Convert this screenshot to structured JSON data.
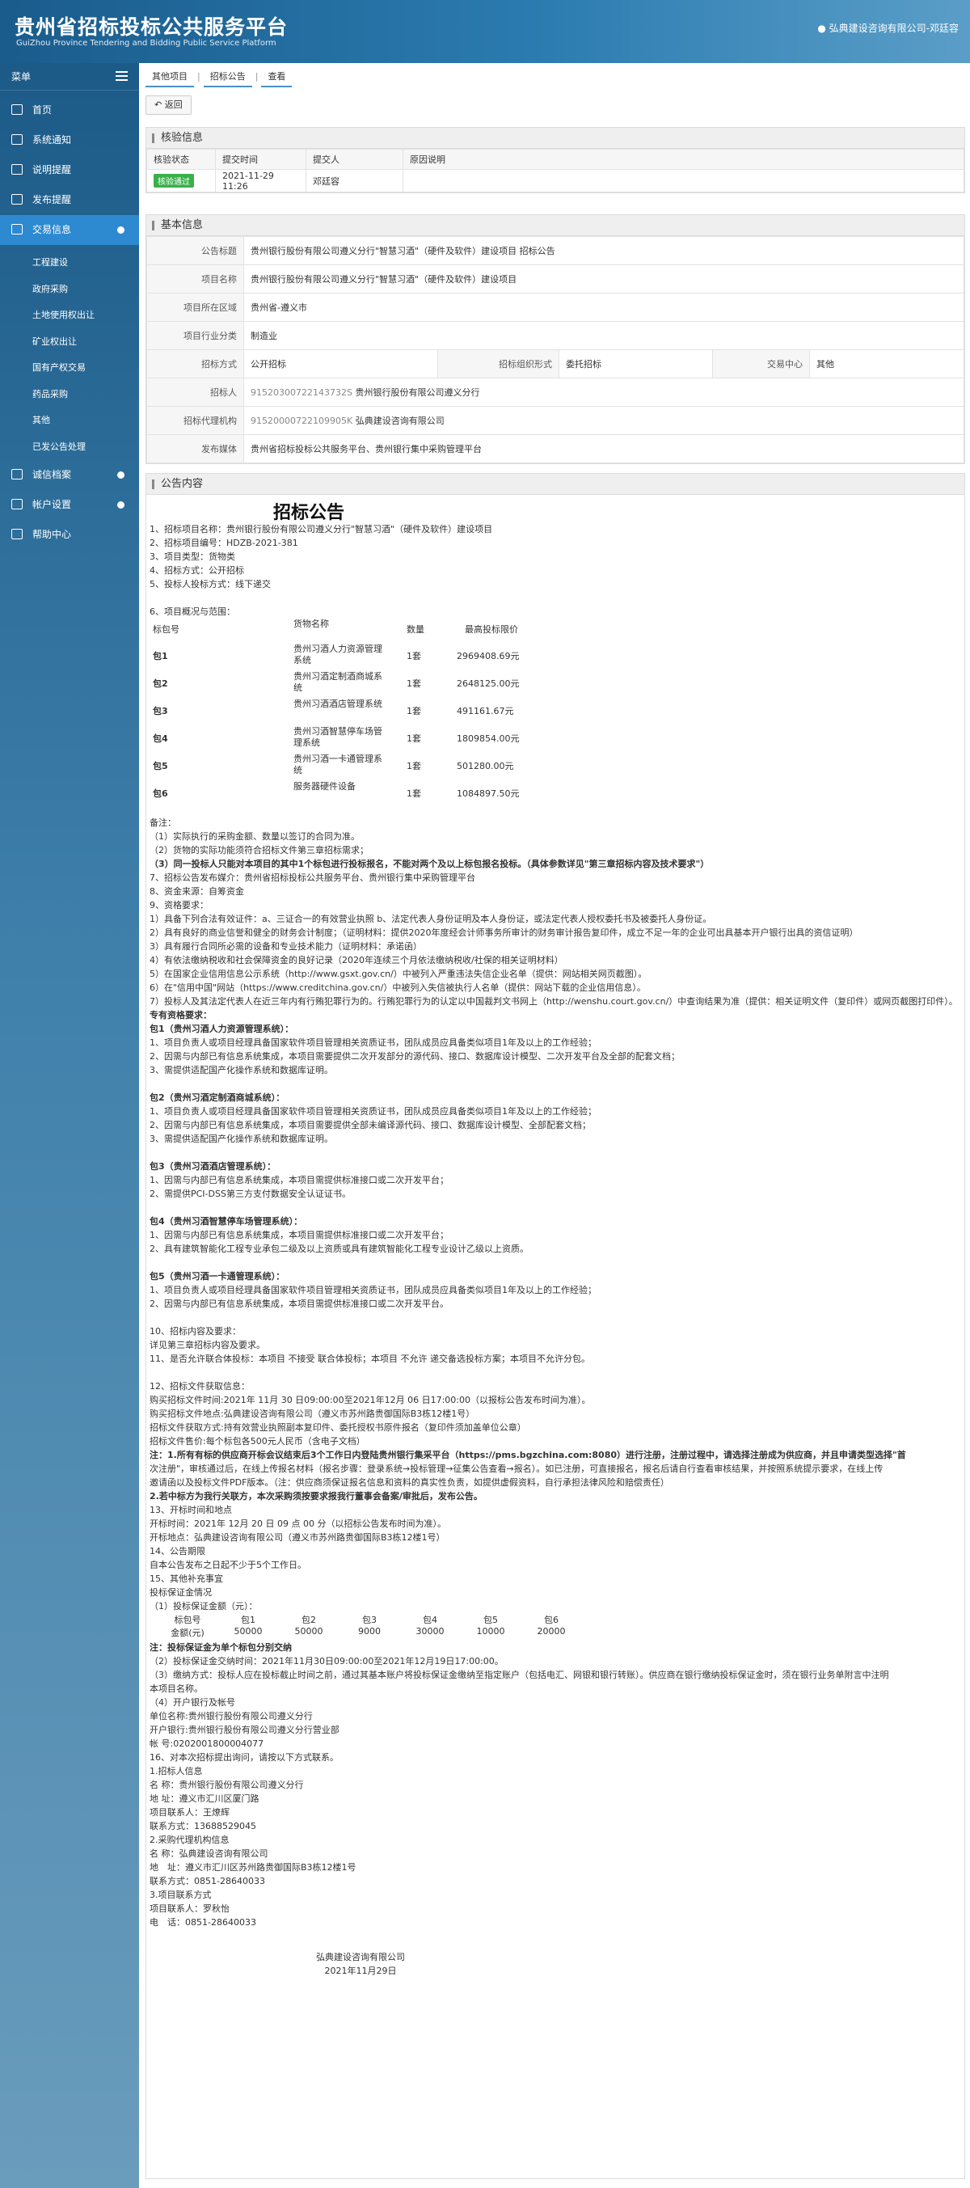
{
  "header": {
    "title_cn": "贵州省招标投标公共服务平台",
    "title_en": "GuiZhou Province Tendering and Bidding Public Service Platform",
    "user": "弘典建设咨询有限公司-邓廷容"
  },
  "sidebar": {
    "menu_label": "菜单",
    "items": [
      {
        "label": "首页",
        "icon": "home-icon"
      },
      {
        "label": "系统通知",
        "icon": "monitor-icon"
      },
      {
        "label": "说明提醒",
        "icon": "book-icon"
      },
      {
        "label": "发布提醒",
        "icon": "doc-icon"
      },
      {
        "label": "交易信息",
        "icon": "list-icon",
        "active": true
      }
    ],
    "sub": [
      "工程建设",
      "政府采购",
      "土地使用权出让",
      "矿业权出让",
      "国有产权交易",
      "药品采购",
      "其他",
      "已发公告处理"
    ],
    "items2": [
      {
        "label": "诚信档案",
        "icon": "archive-icon"
      },
      {
        "label": "帐户设置",
        "icon": "user-icon"
      },
      {
        "label": "帮助中心",
        "icon": "help-icon"
      }
    ]
  },
  "tabs": [
    "其他项目",
    "招标公告",
    "查看"
  ],
  "back": "返回",
  "verify": {
    "title": "核验信息",
    "headers": [
      "核验状态",
      "提交时间",
      "提交人",
      "原因说明"
    ],
    "row": [
      "核验通过",
      "2021-11-29 11:26",
      "邓廷容",
      ""
    ]
  },
  "basic": {
    "title": "基本信息",
    "rows": [
      [
        "公告标题",
        "贵州银行股份有限公司遵义分行\"智慧习酒\"（硬件及软件）建设项目 招标公告"
      ],
      [
        "项目名称",
        "贵州银行股份有限公司遵义分行\"智慧习酒\"（硬件及软件）建设项目"
      ],
      [
        "项目所在区域",
        "贵州省-遵义市"
      ],
      [
        "项目行业分类",
        "制造业"
      ]
    ],
    "method_k": "招标方式",
    "method_v": "公开招标",
    "org_k": "招标组织形式",
    "org_v": "委托招标",
    "center_k": "交易中心",
    "center_v": "其他",
    "bidder_k": "招标人",
    "bidder_code": "91520300722143732S",
    "bidder_v": "贵州银行股份有限公司遵义分行",
    "agent_k": "招标代理机构",
    "agent_code": "91520000722109905K",
    "agent_v": "弘典建设咨询有限公司",
    "media_k": "发布媒体",
    "media_v": "贵州省招标投标公共服务平台、贵州银行集中采购管理平台"
  },
  "notice": {
    "title": "公告内容",
    "doc_title": "招标公告",
    "lines1": [
      "1、招标项目名称：贵州银行股份有限公司遵义分行\"智慧习酒\"（硬件及软件）建设项目",
      "2、招标项目编号：HDZB-2021-381",
      "3、项目类型：货物类",
      "4、招标方式：公开招标",
      "5、投标人投标方式：线下递交",
      "",
      "6、项目概况与范围："
    ],
    "pkg_headers": [
      "标包号",
      "货物名称",
      "数量",
      "最高投标限价"
    ],
    "pkgs": [
      [
        "包1",
        "贵州习酒人力资源管理系统",
        "1套",
        "2969408.69元"
      ],
      [
        "包2",
        "贵州习酒定制酒商城系统",
        "1套",
        "2648125.00元"
      ],
      [
        "包3",
        "贵州习酒酒店管理系统",
        "1套",
        "491161.67元"
      ],
      [
        "包4",
        "贵州习酒智慧停车场管理系统",
        "1套",
        "1809854.00元"
      ],
      [
        "包5",
        "贵州习酒一卡通管理系统",
        "1套",
        "501280.00元"
      ],
      [
        "包6",
        "服务器硬件设备",
        "1套",
        "1084897.50元"
      ]
    ],
    "lines2": [
      "备注：",
      "（1）实际执行的采购金额、数量以签订的合同为准。",
      "（2）货物的实际功能须符合招标文件第三章招标需求；",
      "（3）同一投标人只能对本项目的其中1个标包进行投标报名，不能对两个及以上标包报名投标。（具体参数详见\"第三章招标内容及技术要求\"）",
      "7、招标公告发布媒介：贵州省招标投标公共服务平台、贵州银行集中采购管理平台",
      "8、资金来源：自筹资金",
      "9、资格要求：",
      "1）具备下列合法有效证件：a、三证合一的有效营业执照 b、法定代表人身份证明及本人身份证，或法定代表人授权委托书及被委托人身份证。",
      "2）具有良好的商业信誉和健全的财务会计制度；（证明材料：提供2020年度经会计师事务所审计的财务审计报告复印件，成立不足一年的企业可出具基本开户银行出具的资信证明）",
      "3）具有履行合同所必需的设备和专业技术能力（证明材料：承诺函）",
      "4）有依法缴纳税收和社会保障资金的良好记录（2020年连续三个月依法缴纳税收/社保的相关证明材料）",
      "5）在国家企业信用信息公示系统（http://www.gsxt.gov.cn/）中被列入严重违法失信企业名单（提供：网站相关网页截图）。",
      "6）在\"信用中国\"网站（https://www.creditchina.gov.cn/）中被列入失信被执行人名单（提供：网站下载的企业信用信息）。",
      "7）投标人及其法定代表人在近三年内有行贿犯罪行为的。行贿犯罪行为的认定以中国裁判文书网上（http://wenshu.court.gov.cn/）中查询结果为准（提供：相关证明文件（复印件）或网页截图打印件）。",
      "专有资格要求：",
      "包1（贵州习酒人力资源管理系统）：",
      "1、项目负责人或项目经理具备国家软件项目管理相关资质证书，团队成员应具备类似项目1年及以上的工作经验；",
      "2、因需与内部已有信息系统集成，本项目需要提供二次开发部分的源代码、接口、数据库设计模型、二次开发平台及全部的配套文档；",
      "3、需提供适配国产化操作系统和数据库证明。",
      "",
      "包2（贵州习酒定制酒商城系统）：",
      "1、项目负责人或项目经理具备国家软件项目管理相关资质证书，团队成员应具备类似项目1年及以上的工作经验；",
      "2、因需与内部已有信息系统集成，本项目需要提供全部未编译源代码、接口、数据库设计模型、全部配套文档；",
      "3、需提供适配国产化操作系统和数据库证明。",
      "",
      "包3（贵州习酒酒店管理系统）：",
      "1、因需与内部已有信息系统集成，本项目需提供标准接口或二次开发平台；",
      "2、需提供PCI-DSS第三方支付数据安全认证证书。",
      "",
      "包4（贵州习酒智慧停车场管理系统）：",
      "1、因需与内部已有信息系统集成，本项目需提供标准接口或二次开发平台；",
      "2、具有建筑智能化工程专业承包二级及以上资质或具有建筑智能化工程专业设计乙级以上资质。",
      "",
      "包5（贵州习酒一卡通管理系统）：",
      "1、项目负责人或项目经理具备国家软件项目管理相关资质证书，团队成员应具备类似项目1年及以上的工作经验；",
      "2、因需与内部已有信息系统集成，本项目需提供标准接口或二次开发平台。",
      "",
      "10、招标内容及要求：",
      "详见第三章招标内容及要求。",
      "11、是否允许联合体投标：本项目 不接受 联合体投标；本项目 不允许 递交备选投标方案；本项目不允许分包。",
      "",
      "12、招标文件获取信息：",
      "购买招标文件时间:2021年 11月 30 日09:00:00至2021年12月 06 日17:00:00（以报标公告发布时间为准）。",
      "购买招标文件地点:弘典建设咨询有限公司（遵义市苏州路贵御国际B3栋12楼1号）",
      "招标文件获取方式:持有效营业执照副本复印件、委托授权书原件报名（复印件须加盖单位公章）",
      "招标文件售价:每个标包各500元人民币（含电子文档）",
      "注：1.所有有标的供应商开标会议结束后3个工作日内登陆贵州银行集采平台（https://pms.bgzchina.com:8080）进行注册，注册过程中，请选择注册成为供应商，并且申请类型选择\"首",
      "次注册\"，审核通过后，在线上传报名材料（报名步骤：登录系统→投标管理→征集公告查看→报名）。如已注册，可直接报名，报名后请自行查看审核结果，并按照系统提示要求，在线上传",
      "邀请函以及投标文件PDF版本。（注：供应商须保证报名信息和资料的真实性负责，如提供虚假资料，自行承担法律风险和赔偿责任）",
      "2.若中标方为我行关联方，本次采购须按要求报我行董事会备案/审批后，发布公告。",
      "13、开标时间和地点",
      "开标时间：2021年 12月 20 日 09 点 00 分（以招标公告发布时间为准）。",
      "开标地点：弘典建设咨询有限公司（遵义市苏州路贵御国际B3栋12楼1号）",
      "14、公告期限",
      "自本公告发布之日起不少于5个工作日。",
      "15、其他补充事宜",
      "投标保证金情况",
      "（1）投标保证金额（元）："
    ],
    "dep_headers": [
      "标包号",
      "包1",
      "包2",
      "包3",
      "包4",
      "包5",
      "包6"
    ],
    "dep_values": [
      "金额(元)",
      "50000",
      "50000",
      "9000",
      "30000",
      "10000",
      "20000"
    ],
    "lines3": [
      "注：投标保证金为单个标包分别交纳",
      "（2）投标保证金交纳时间：2021年11月30日09:00:00至2021年12月19日17:00:00。",
      "（3）缴纳方式：投标人应在投标截止时间之前，通过其基本账户将投标保证金缴纳至指定账户（包括电汇、网银和银行转账）。供应商在银行缴纳投标保证金时，须在银行业务单附言中注明",
      "本项目名称。",
      "（4）开户银行及帐号",
      "单位名称:贵州银行股份有限公司遵义分行",
      "开户银行:贵州银行股份有限公司遵义分行营业部",
      "帐 号:0202001800004077",
      "16、对本次招标提出询问，请按以下方式联系。",
      "1.招标人信息",
      "名 称：贵州银行股份有限公司遵义分行",
      "地 址：遵义市汇川区厦门路",
      "项目联系人：王燎辉",
      "联系方式：13688529045",
      "2.采购代理机构信息",
      "名 称：弘典建设咨询有限公司",
      "地　址：遵义市汇川区苏州路贵御国际B3栋12楼1号",
      "联系方式：0851-28640033",
      "3.项目联系方式",
      "项目联系人：罗秋怡",
      "电　话：0851-28640033"
    ],
    "sign_org": "弘典建设咨询有限公司",
    "sign_date": "2021年11月29日"
  }
}
